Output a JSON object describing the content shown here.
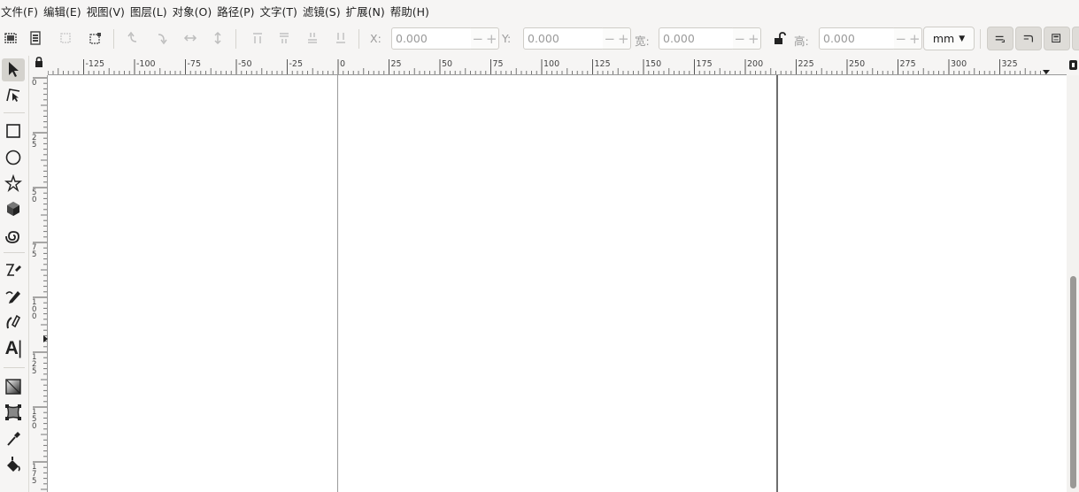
{
  "menu": [
    {
      "label": "文件(F)"
    },
    {
      "label": "编辑(E)"
    },
    {
      "label": "视图(V)"
    },
    {
      "label": "图层(L)"
    },
    {
      "label": "对象(O)"
    },
    {
      "label": "路径(P)"
    },
    {
      "label": "文字(T)"
    },
    {
      "label": "滤镜(S)"
    },
    {
      "label": "扩展(N)"
    },
    {
      "label": "帮助(H)"
    }
  ],
  "toolbar": {
    "x_label": "X:",
    "x_value": "0.000",
    "y_label": "Y:",
    "y_value": "0.000",
    "w_label": "宽:",
    "w_value": "0.000",
    "h_label": "高:",
    "h_value": "0.000",
    "minus": "−",
    "plus": "+",
    "unit": "mm"
  },
  "ruler": {
    "h_labels": [
      "-125",
      "-100",
      "-75",
      "-50",
      "-25",
      "0",
      "25",
      "50",
      "75",
      "100",
      "125",
      "150",
      "175",
      "200",
      "225",
      "250",
      "275",
      "300",
      "325"
    ],
    "v_labels": [
      "0",
      "25",
      "50",
      "75",
      "100",
      "125",
      "150",
      "175"
    ]
  },
  "tools": [
    {
      "name": "selector-tool",
      "icon": "arrow-icon"
    },
    {
      "name": "node-tool",
      "icon": "node-icon"
    },
    {
      "name": "rect-tool",
      "icon": "rectangle-icon"
    },
    {
      "name": "ellipse-tool",
      "icon": "circle-icon"
    },
    {
      "name": "star-tool",
      "icon": "star-icon"
    },
    {
      "name": "3dbox-tool",
      "icon": "cube-icon"
    },
    {
      "name": "spiral-tool",
      "icon": "spiral-icon"
    },
    {
      "name": "bezier-tool",
      "icon": "bezier-pen-icon"
    },
    {
      "name": "pencil-tool",
      "icon": "pencil-icon"
    },
    {
      "name": "calligraphy-tool",
      "icon": "calligraphy-icon"
    },
    {
      "name": "text-tool",
      "icon": "text-icon"
    },
    {
      "name": "gradient-tool",
      "icon": "gradient-icon"
    },
    {
      "name": "mesh-tool",
      "icon": "mesh-icon"
    },
    {
      "name": "dropper-tool",
      "icon": "dropper-icon"
    },
    {
      "name": "paint-bucket-tool",
      "icon": "bucket-icon"
    }
  ],
  "text_tool_glyph": "A"
}
